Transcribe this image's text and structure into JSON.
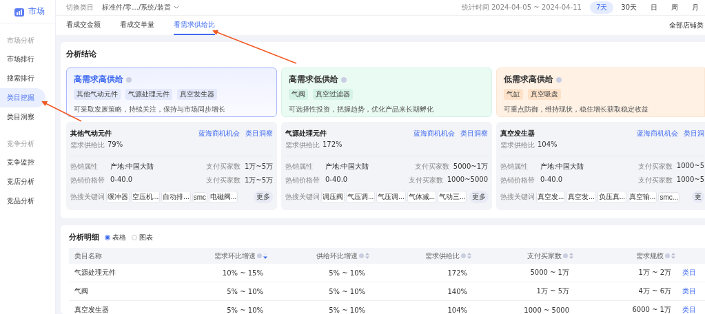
{
  "sidebar": {
    "logo_text": "市场",
    "sections": [
      {
        "title": "市场分析",
        "items": [
          {
            "label": "市场排行",
            "selected": false
          },
          {
            "label": "搜索排行",
            "selected": false
          },
          {
            "label": "类目挖掘",
            "selected": true
          },
          {
            "label": "类目洞察",
            "selected": false
          }
        ]
      },
      {
        "title": "竞争分析",
        "items": [
          {
            "label": "竞争监控",
            "selected": false
          },
          {
            "label": "竞店分析",
            "selected": false
          },
          {
            "label": "竞品分析",
            "selected": false
          }
        ]
      }
    ]
  },
  "topbar": {
    "switch_label": "切换类目",
    "category": "标准件/零.../系统/装置",
    "stat_time": "统计时间 2024-04-05 ~ 2024-04-11",
    "periods": [
      {
        "label": "7天",
        "selected": true
      },
      {
        "label": "30天",
        "selected": false
      },
      {
        "label": "日",
        "selected": false
      },
      {
        "label": "周",
        "selected": false
      },
      {
        "label": "月",
        "selected": false
      }
    ]
  },
  "tabs": [
    {
      "label": "看成交金额",
      "selected": false
    },
    {
      "label": "看成交单量",
      "selected": false
    },
    {
      "label": "看需求供给比",
      "selected": true
    }
  ],
  "store_filter": "全部店铺类",
  "conclusion": {
    "title": "分析结论",
    "groups": [
      {
        "kind": "high-high",
        "selected": true,
        "title": "高需求高供给",
        "tags": [
          "其他气动元件",
          "气源处理元件",
          "真空发生器"
        ],
        "desc": "可采取发展策略，持续关注，保持与市场同步增长"
      },
      {
        "kind": "high-low",
        "selected": false,
        "title": "高需求低供给",
        "tags": [
          "气阀",
          "真空过滤器"
        ],
        "desc": "可选择性投资，把握趋势，优化产品来长期孵化"
      },
      {
        "kind": "low-high",
        "selected": false,
        "title": "低需求高供给",
        "tags": [
          "气缸",
          "真空吸盘"
        ],
        "desc": "可重点防御，维持现状，稳住增长获取稳定收益"
      }
    ],
    "details": [
      {
        "name": "其他气动元件",
        "links": [
          "蓝海商机机会",
          "类目洞察"
        ],
        "ratio_label": "需求供给比",
        "ratio": "79%",
        "attrs": [
          {
            "label": "热销属性",
            "value": "产地:中国大陆",
            "buyers_label": "支付买家数",
            "buyers": "1万~5万"
          },
          {
            "label": "热销价格带",
            "value": "0-40.0",
            "buyers_label": "支付买家数",
            "buyers": "1万~5万"
          }
        ],
        "keywords_label": "热搜关键词",
        "keywords": [
          "缓冲器",
          "空压机...",
          "自动排...",
          "smc",
          "电磁阀..."
        ],
        "more": "更多"
      },
      {
        "name": "气源处理元件",
        "links": [
          "蓝海商机机会",
          "类目洞察"
        ],
        "ratio_label": "需求供给比",
        "ratio": "172%",
        "attrs": [
          {
            "label": "热销属性",
            "value": "产地:中国大陆",
            "buyers_label": "支付买家数",
            "buyers": "5000~1万"
          },
          {
            "label": "热销价格带",
            "value": "0-40.0",
            "buyers_label": "支付买家数",
            "buyers": "1000~5000"
          }
        ],
        "keywords_label": "热搜关键词",
        "keywords": [
          "调压阀",
          "气压调...",
          "气压调...",
          "气体减...",
          "气动三..."
        ],
        "more": "更多"
      },
      {
        "name": "真空发生器",
        "links": [
          "蓝海商机机会",
          "类目洞"
        ],
        "ratio_label": "需求供给比",
        "ratio": "104%",
        "attrs": [
          {
            "label": "热销属性",
            "value": "产地:中国大陆",
            "buyers_label": "支付买家数",
            "buyers": "1000~5"
          },
          {
            "label": "热销价格带",
            "value": "0-40.0",
            "buyers_label": "支付买家数",
            "buyers": "1000~5"
          }
        ],
        "keywords_label": "热搜关键词",
        "keywords": [
          "真空发...",
          "真空发...",
          "负压真...",
          "真空输...",
          "smc..."
        ],
        "more": "更"
      }
    ]
  },
  "detail": {
    "title": "分析明细",
    "views": [
      {
        "label": "表格",
        "selected": true
      },
      {
        "label": "图表",
        "selected": false
      }
    ],
    "columns": [
      {
        "label": "类目名称",
        "info": false,
        "sortable": false,
        "sorted": false
      },
      {
        "label": "需求环比增速",
        "info": true,
        "sortable": true,
        "sorted": true
      },
      {
        "label": "供给环比增速",
        "info": true,
        "sortable": true,
        "sorted": false
      },
      {
        "label": "需求供给比",
        "info": true,
        "sortable": true,
        "sorted": false
      },
      {
        "label": "支付买家数",
        "info": true,
        "sortable": true,
        "sorted": false
      },
      {
        "label": "需求规模",
        "info": true,
        "sortable": true,
        "sorted": false
      }
    ],
    "rows": [
      {
        "cells": [
          "气源处理元件",
          "10% ~ 15%",
          "5% ~ 10%",
          "172%",
          "5000 ~ 1万",
          "1万 ~ 2万"
        ],
        "action": "类目"
      },
      {
        "cells": [
          "气阀",
          "5% ~ 10%",
          "5% ~ 10%",
          "140%",
          "1万 ~ 5万",
          "4万 ~ 6万"
        ],
        "action": "类目"
      },
      {
        "cells": [
          "真空发生器",
          "5% ~ 10%",
          "5% ~ 10%",
          "104%",
          "1000 ~ 5000",
          "6000 ~ 1万"
        ],
        "action": "类目"
      }
    ]
  }
}
